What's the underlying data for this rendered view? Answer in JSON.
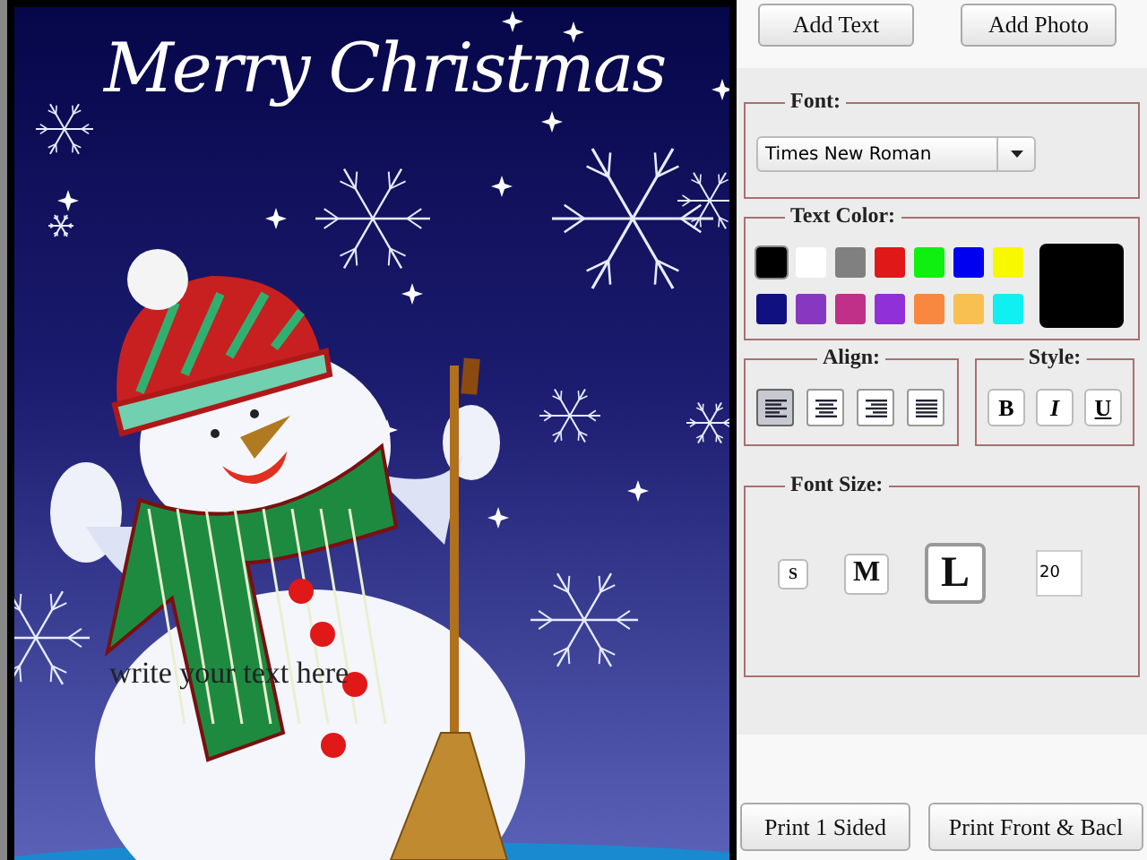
{
  "card": {
    "greeting": "Merry Christmas",
    "text_box": "write your text here"
  },
  "top_buttons": [
    "Add Text",
    "Add Photo"
  ],
  "font": {
    "legend": "Font:",
    "value": "Times New Roman"
  },
  "text_color": {
    "legend": "Text Color:",
    "swatches": [
      {
        "color": "#000000",
        "selected": true
      },
      {
        "color": "#ffffff",
        "selected": false
      },
      {
        "color": "#808080",
        "selected": false
      },
      {
        "color": "#e01818",
        "selected": false
      },
      {
        "color": "#10f010",
        "selected": false
      },
      {
        "color": "#0000f0",
        "selected": false
      },
      {
        "color": "#f8f800",
        "selected": false
      },
      {
        "color": "#101080",
        "selected": false
      },
      {
        "color": "#8838c0",
        "selected": false
      },
      {
        "color": "#c03088",
        "selected": false
      },
      {
        "color": "#9030d8",
        "selected": false
      },
      {
        "color": "#f88840",
        "selected": false
      },
      {
        "color": "#f8c050",
        "selected": false
      },
      {
        "color": "#10f0f0",
        "selected": false
      }
    ]
  },
  "align": {
    "legend": "Align:",
    "options": [
      {
        "kind": "left",
        "selected": true
      },
      {
        "kind": "center",
        "selected": false
      },
      {
        "kind": "right",
        "selected": false
      },
      {
        "kind": "justify",
        "selected": false
      }
    ]
  },
  "style": {
    "legend": "Style:",
    "options": [
      {
        "kind": "bold",
        "label": "B",
        "selected": false
      },
      {
        "kind": "italic",
        "label": "I",
        "selected": false
      },
      {
        "kind": "underline",
        "label": "U",
        "selected": false
      }
    ]
  },
  "font_size": {
    "legend": "Font Size:",
    "options": [
      {
        "kind": "small",
        "label": "S",
        "selected": false
      },
      {
        "kind": "medium",
        "label": "M",
        "selected": false
      },
      {
        "kind": "large",
        "label": "L",
        "selected": true
      }
    ],
    "value": "20"
  },
  "bottom_buttons": [
    "Print 1 Sided",
    "Print Front & Bacl"
  ]
}
